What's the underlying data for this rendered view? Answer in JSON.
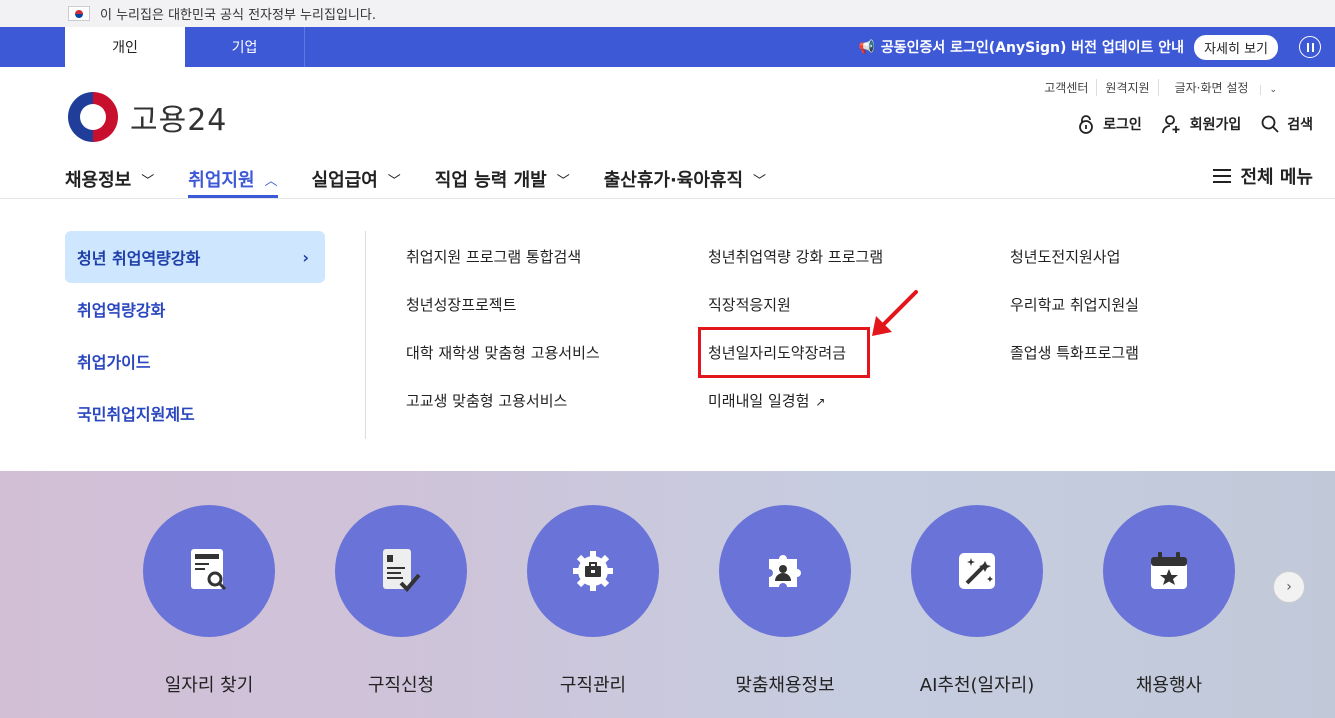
{
  "gov_banner": {
    "text": "이 누리집은 대한민국 공식 전자정부 누리집입니다."
  },
  "topbar": {
    "tabs": [
      {
        "label": "개인"
      },
      {
        "label": "기업"
      }
    ],
    "notice": "공동인증서 로그인(AnySign) 버전 업데이트 안내",
    "detail_label": "자세히 보기"
  },
  "logo": {
    "text": "고용24"
  },
  "util": {
    "items": [
      "고객센터",
      "원격지원",
      "글자·화면 설정"
    ]
  },
  "account": {
    "login": "로그인",
    "signup": "회원가입",
    "search": "검색"
  },
  "gnb": {
    "items": [
      {
        "label": "채용정보"
      },
      {
        "label": "취업지원"
      },
      {
        "label": "실업급여"
      },
      {
        "label": "직업 능력 개발"
      },
      {
        "label": "출산휴가·육아휴직"
      }
    ],
    "all_menu": "전체 메뉴"
  },
  "dropdown": {
    "side": [
      "청년 취업역량강화",
      "취업역량강화",
      "취업가이드",
      "국민취업지원제도"
    ],
    "col1": [
      "취업지원 프로그램 통합검색",
      "청년성장프로젝트",
      "대학 재학생 맞춤형 고용서비스",
      "고교생 맞춤형 고용서비스"
    ],
    "col2": [
      "청년취업역량 강화 프로그램",
      "직장적응지원",
      "청년일자리도약장려금",
      "미래내일 일경험"
    ],
    "col3": [
      "청년도전지원사업",
      "우리학교 취업지원실",
      "졸업생 특화프로그램"
    ]
  },
  "services": [
    {
      "label": "일자리 찾기",
      "icon": "job-search-icon"
    },
    {
      "label": "구직신청",
      "icon": "application-check-icon"
    },
    {
      "label": "구직관리",
      "icon": "briefcase-gear-icon"
    },
    {
      "label": "맞춤채용정보",
      "icon": "puzzle-person-icon"
    },
    {
      "label": "AI추천(일자리)",
      "icon": "magic-wand-icon"
    },
    {
      "label": "채용행사",
      "icon": "calendar-star-icon"
    }
  ],
  "colors": {
    "brand_blue": "#3d59d6",
    "active_bg": "#cfe6ff",
    "service_circle": "#6a74d8",
    "highlight": "#e3161c"
  }
}
